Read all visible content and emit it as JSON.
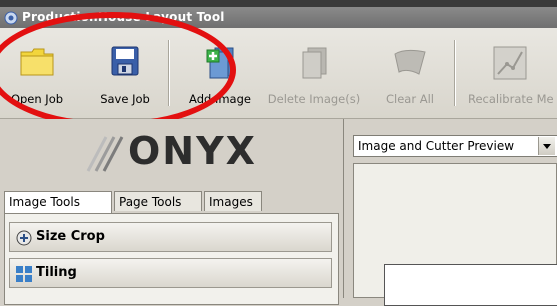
{
  "window": {
    "title": "ProductionHouse Layout Tool"
  },
  "toolbar": {
    "open_job": "Open Job",
    "save_job": "Save Job",
    "add_image": "Add Image",
    "delete_images": "Delete Image(s)",
    "clear_all": "Clear All",
    "recalibrate": "Recalibrate Me"
  },
  "logo": {
    "text": "ONYX"
  },
  "tabs": {
    "image_tools": "Image Tools",
    "page_tools": "Page Tools",
    "images": "Images"
  },
  "panels": {
    "size_crop": "Size Crop",
    "tiling": "Tiling"
  },
  "preview": {
    "selected": "Image and Cutter Preview"
  },
  "colors": {
    "annotation": "#e31010",
    "folder": "#f2d53c",
    "floppy": "#3a5fa8"
  }
}
